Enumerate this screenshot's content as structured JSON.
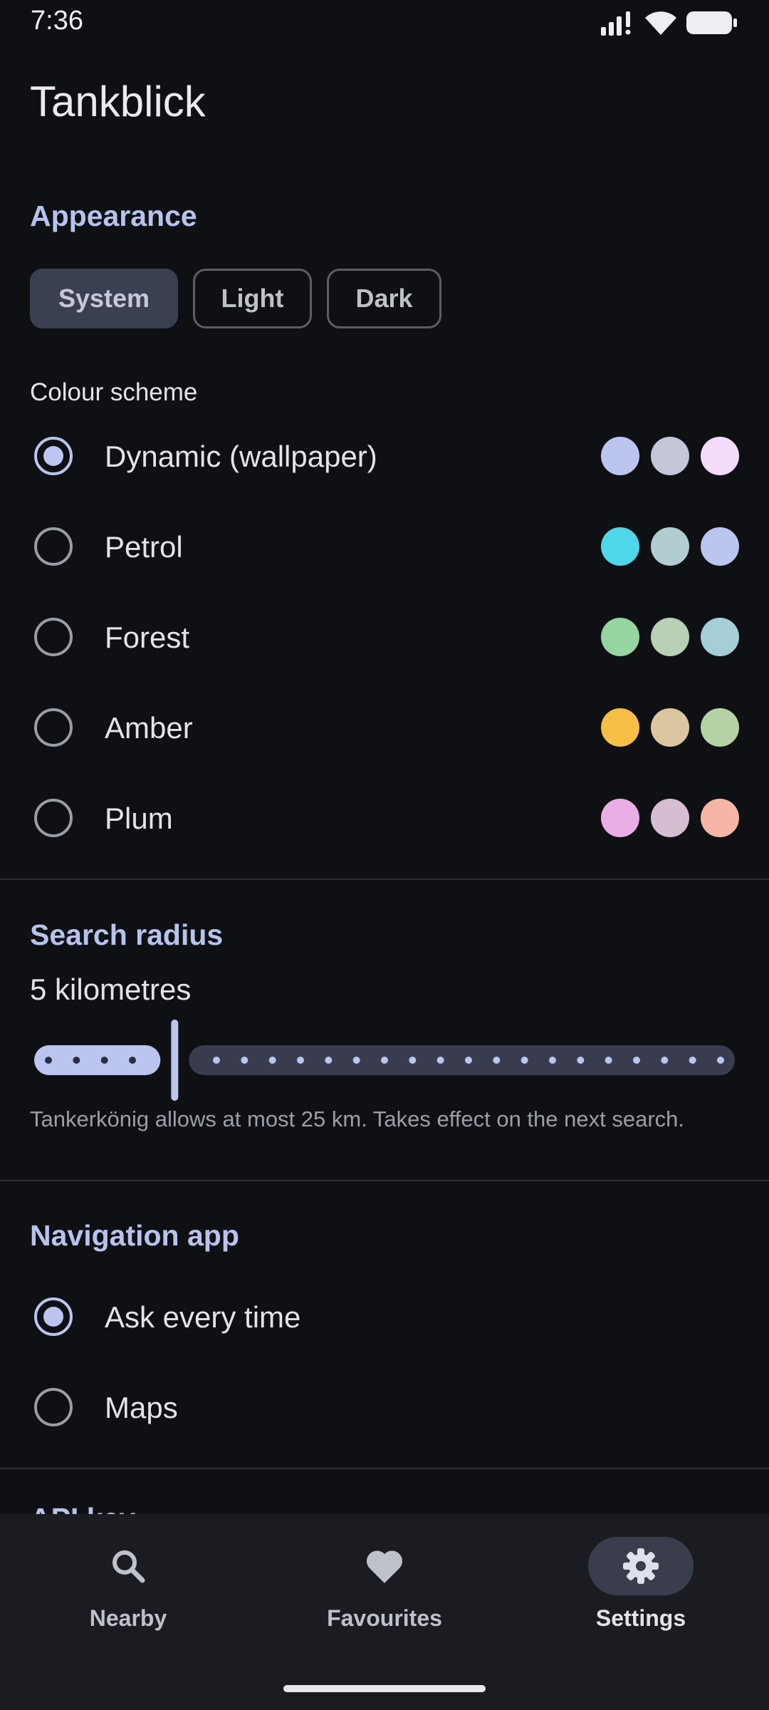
{
  "status": {
    "time": "7:36"
  },
  "app": {
    "title": "Tankblick"
  },
  "appearance": {
    "section_title": "Appearance",
    "theme_options": [
      "System",
      "Light",
      "Dark"
    ],
    "selected_theme": "System",
    "colour_scheme_label": "Colour scheme",
    "schemes": [
      {
        "name": "Dynamic (wallpaper)",
        "selected": true,
        "colors": [
          "#bcc5ee",
          "#c4c6da",
          "#f5dcfb"
        ]
      },
      {
        "name": "Petrol",
        "selected": false,
        "colors": [
          "#4fd6e8",
          "#b2cdd2",
          "#bcc5ee"
        ]
      },
      {
        "name": "Forest",
        "selected": false,
        "colors": [
          "#96d4a2",
          "#b9cfb6",
          "#a5ced6"
        ]
      },
      {
        "name": "Amber",
        "selected": false,
        "colors": [
          "#f6be44",
          "#dcc6a0",
          "#b5d2a4"
        ]
      },
      {
        "name": "Plum",
        "selected": false,
        "colors": [
          "#eaaee6",
          "#d7bdd2",
          "#f5b6a5"
        ]
      }
    ]
  },
  "search_radius": {
    "section_title": "Search radius",
    "value_label": "5 kilometres",
    "value_km": 5,
    "min_km": 1,
    "max_km": 25,
    "hint": "Tankerkönig allows at most 25 km. Takes effect on the next search."
  },
  "navigation_app": {
    "section_title": "Navigation app",
    "options": [
      {
        "name": "Ask every time",
        "selected": true
      },
      {
        "name": "Maps",
        "selected": false
      }
    ]
  },
  "next_section_partial": "API key",
  "bottom_nav": {
    "items": [
      {
        "label": "Nearby",
        "icon": "search-icon",
        "active": false
      },
      {
        "label": "Favourites",
        "icon": "heart-icon",
        "active": false
      },
      {
        "label": "Settings",
        "icon": "gear-icon",
        "active": true
      }
    ]
  },
  "colors": {
    "accent": "#bcc5f0",
    "background": "#0f1014",
    "surface": "#1b1c22"
  }
}
